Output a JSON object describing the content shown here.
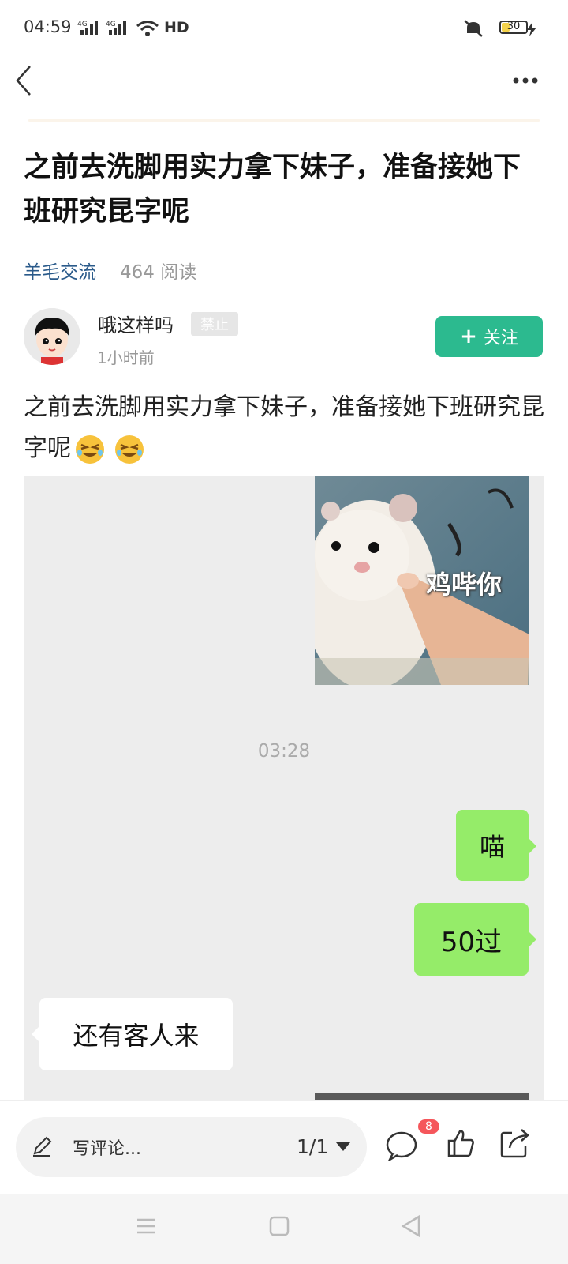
{
  "status_bar": {
    "time": "04:59",
    "signal1": "4G",
    "signal2": "4G",
    "network": "HD",
    "battery": "30",
    "battery_level": 0.3
  },
  "article": {
    "title": "之前去洗脚用实力拿下妹子，准备接她下班研究昆字呢",
    "channel": "羊毛交流",
    "reads": "464 阅读",
    "author": "哦这样吗",
    "author_badge": "禁止",
    "post_time": "1小时前",
    "follow_label": "关注",
    "body": "之前去洗脚用实力拿下妹子，准备接她下班研究昆字呢"
  },
  "chat": {
    "sticker_caption": "鸡哔你",
    "time": "03:28",
    "messages": [
      {
        "side": "right",
        "text": "喵"
      },
      {
        "side": "right",
        "text": "50过"
      },
      {
        "side": "left",
        "text": "还有客人来"
      }
    ]
  },
  "bottom_bar": {
    "comment_placeholder": "写评论...",
    "page_counter": "1/1",
    "comment_count": "8"
  },
  "colors": {
    "accent": "#2cba8f",
    "channel_link": "#2a5a8a",
    "bubble_right": "#95ec69",
    "badge": "#f5565b"
  }
}
